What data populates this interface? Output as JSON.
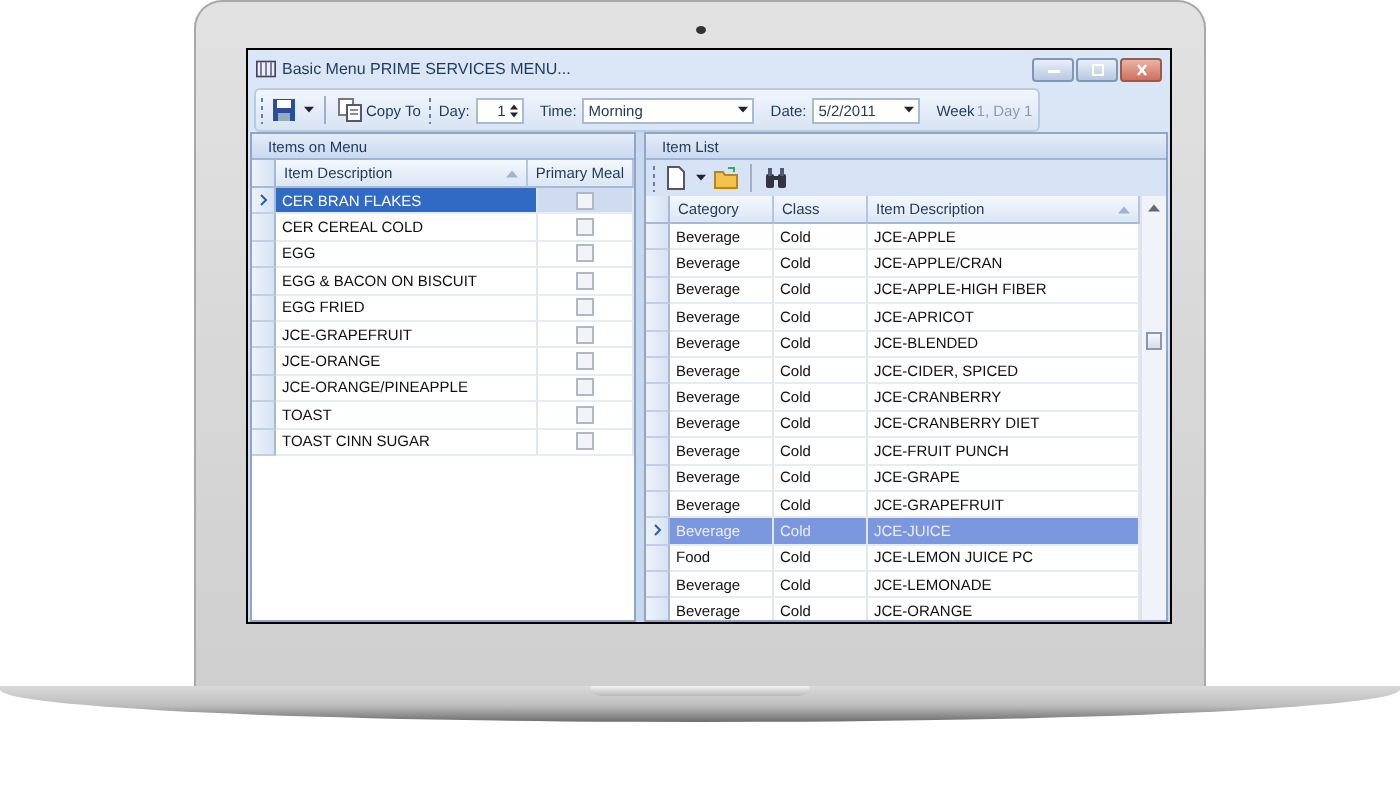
{
  "window": {
    "title": "Basic Menu PRIME SERVICES MENU..."
  },
  "toolbar": {
    "copy_button": "Copy To",
    "day_label": "Day:",
    "day_value": "1",
    "time_label": "Time:",
    "time_value": "Morning",
    "date_label": "Date:",
    "date_value": "5/2/2011",
    "week_label": "Week",
    "week_value": "1, Day 1"
  },
  "menu_panel": {
    "title": "Items on Menu",
    "columns": [
      {
        "label": "Item Description",
        "sorted": true
      },
      {
        "label": "Primary Meal",
        "sorted": false
      }
    ],
    "rows": [
      {
        "description": "CER BRAN FLAKES",
        "primary_meal": false,
        "selected": true
      },
      {
        "description": "CER CEREAL COLD",
        "primary_meal": false,
        "selected": false
      },
      {
        "description": "EGG",
        "primary_meal": false,
        "selected": false
      },
      {
        "description": "EGG & BACON ON BISCUIT",
        "primary_meal": false,
        "selected": false
      },
      {
        "description": "EGG FRIED",
        "primary_meal": false,
        "selected": false
      },
      {
        "description": "JCE-GRAPEFRUIT",
        "primary_meal": false,
        "selected": false
      },
      {
        "description": "JCE-ORANGE",
        "primary_meal": false,
        "selected": false
      },
      {
        "description": "JCE-ORANGE/PINEAPPLE",
        "primary_meal": false,
        "selected": false
      },
      {
        "description": "TOAST",
        "primary_meal": false,
        "selected": false
      },
      {
        "description": "TOAST CINN SUGAR",
        "primary_meal": false,
        "selected": false
      }
    ]
  },
  "item_list": {
    "title": "Item List",
    "columns": [
      {
        "label": "Category",
        "sorted": false
      },
      {
        "label": "Class",
        "sorted": false
      },
      {
        "label": "Item Description",
        "sorted": true
      }
    ],
    "rows": [
      {
        "category": "Beverage",
        "class": "Cold",
        "description": "JCE-APPLE",
        "selected": false
      },
      {
        "category": "Beverage",
        "class": "Cold",
        "description": "JCE-APPLE/CRAN",
        "selected": false
      },
      {
        "category": "Beverage",
        "class": "Cold",
        "description": "JCE-APPLE-HIGH FIBER",
        "selected": false
      },
      {
        "category": "Beverage",
        "class": "Cold",
        "description": "JCE-APRICOT",
        "selected": false
      },
      {
        "category": "Beverage",
        "class": "Cold",
        "description": "JCE-BLENDED",
        "selected": false
      },
      {
        "category": "Beverage",
        "class": "Cold",
        "description": "JCE-CIDER, SPICED",
        "selected": false
      },
      {
        "category": "Beverage",
        "class": "Cold",
        "description": "JCE-CRANBERRY",
        "selected": false
      },
      {
        "category": "Beverage",
        "class": "Cold",
        "description": "JCE-CRANBERRY DIET",
        "selected": false
      },
      {
        "category": "Beverage",
        "class": "Cold",
        "description": "JCE-FRUIT PUNCH",
        "selected": false
      },
      {
        "category": "Beverage",
        "class": "Cold",
        "description": "JCE-GRAPE",
        "selected": false
      },
      {
        "category": "Beverage",
        "class": "Cold",
        "description": "JCE-GRAPEFRUIT",
        "selected": false
      },
      {
        "category": "Beverage",
        "class": "Cold",
        "description": "JCE-JUICE",
        "selected": true
      },
      {
        "category": "Food",
        "class": "Cold",
        "description": "JCE-LEMON JUICE PC",
        "selected": false
      },
      {
        "category": "Beverage",
        "class": "Cold",
        "description": "JCE-LEMONADE",
        "selected": false
      },
      {
        "category": "Beverage",
        "class": "Cold",
        "description": "JCE-ORANGE",
        "selected": false
      }
    ]
  }
}
